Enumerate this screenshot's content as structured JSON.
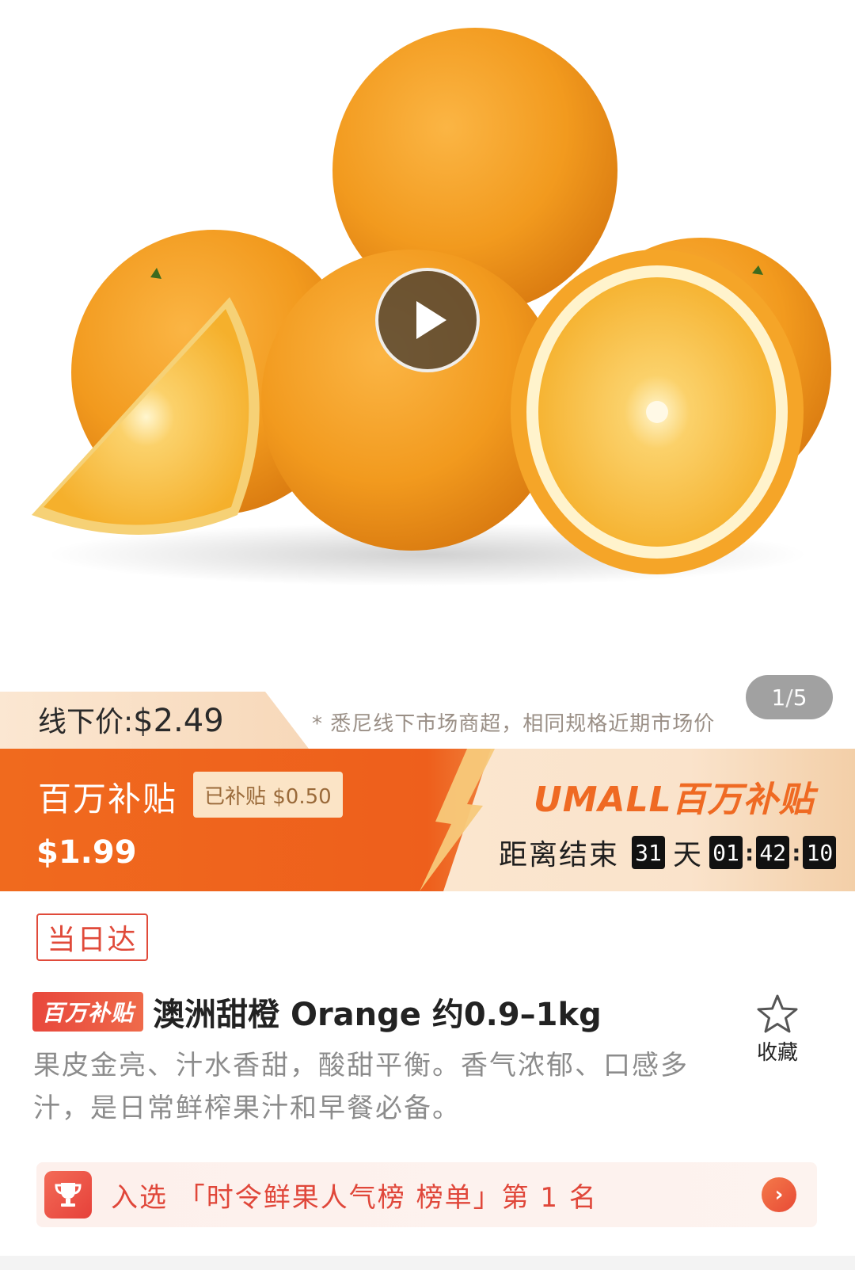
{
  "gallery": {
    "current": "1",
    "total": "5",
    "separator": "/"
  },
  "offline_price": {
    "label": "线下价:",
    "price": "$2.49",
    "note": "* 悉尼线下市场商超，相同规格近期市场价"
  },
  "subsidy": {
    "title": "百万补贴",
    "badge": "已补贴 $0.50",
    "price": "$1.99",
    "logo": "UMALL百万补贴",
    "countdown_label": "距离结束",
    "days": "31",
    "days_unit": "天",
    "hours": "01",
    "minutes": "42",
    "seconds": "10",
    "accent_color": "#f06a1e"
  },
  "product": {
    "delivery_tag": "当日达",
    "subsidy_tag": "百万补贴",
    "title": "澳洲甜橙 Orange 约0.9–1kg",
    "description": "果皮金亮、汁水香甜，酸甜平衡。香气浓郁、口感多汁，是日常鲜榨果汁和早餐必备。",
    "favorite_label": "收藏"
  },
  "ranking": {
    "text": "入选 「时令鲜果人气榜 榜单」第 1 名",
    "arrow": "›"
  },
  "icons": {
    "play": "play-icon",
    "star": "star-outline-icon",
    "trophy": "trophy-icon",
    "chevron": "chevron-right-icon"
  }
}
